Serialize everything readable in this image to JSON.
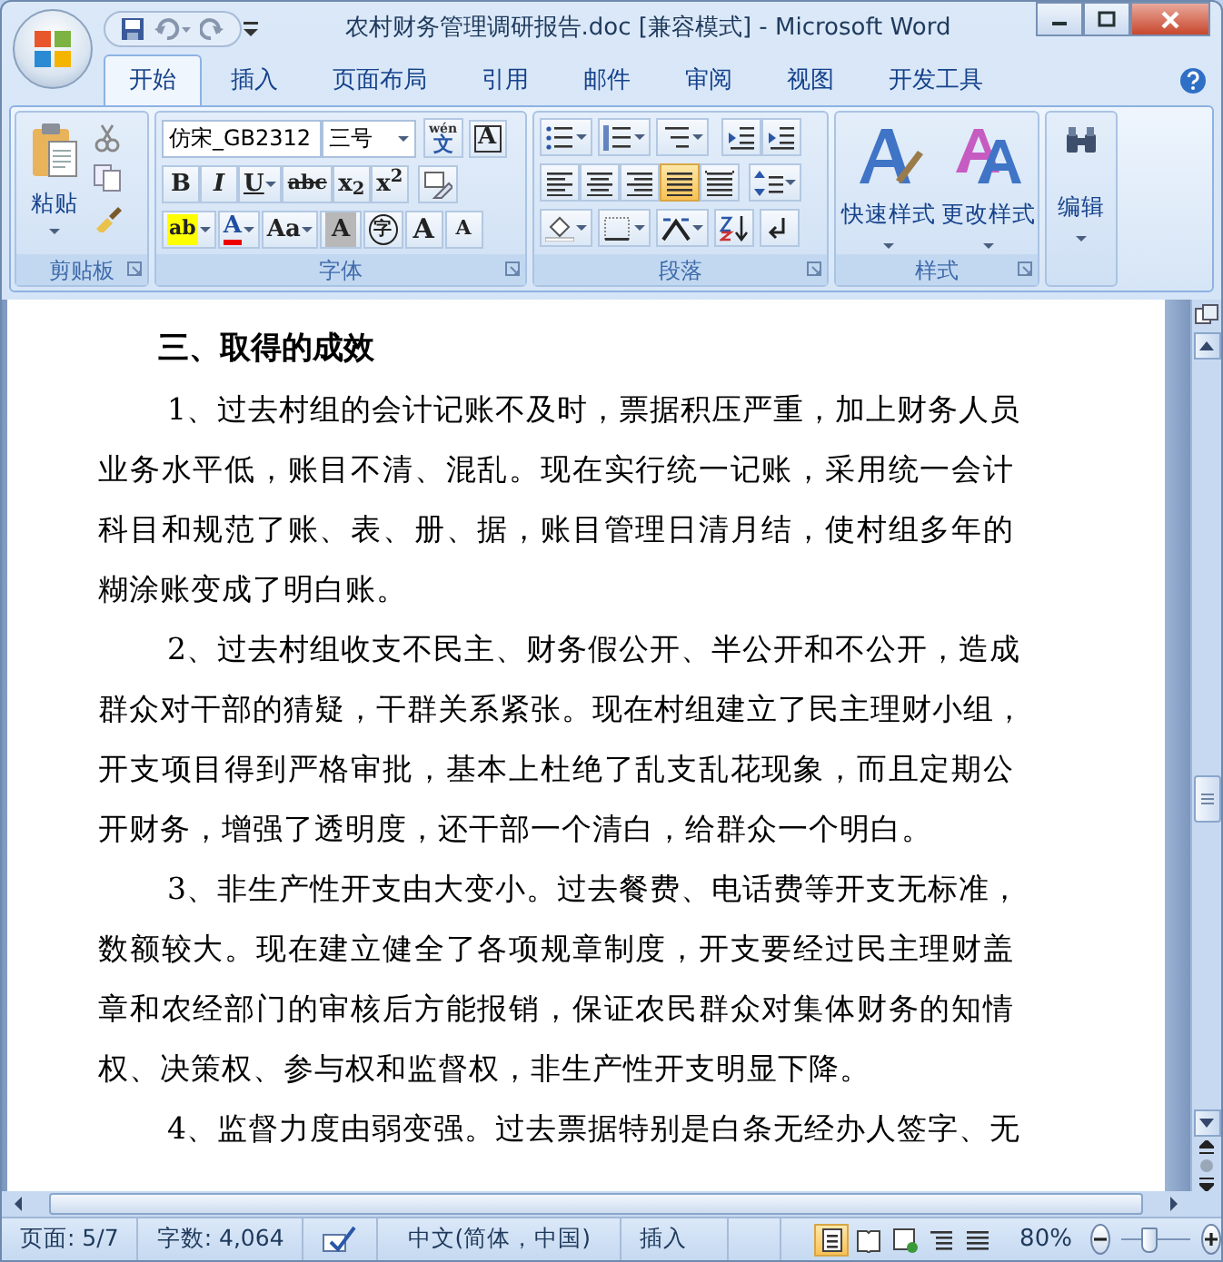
{
  "window": {
    "title": "农村财务管理调研报告.doc [兼容模式] - Microsoft Word"
  },
  "tabs": [
    {
      "label": "开始",
      "selected": true
    },
    {
      "label": "插入",
      "selected": false
    },
    {
      "label": "页面布局",
      "selected": false
    },
    {
      "label": "引用",
      "selected": false
    },
    {
      "label": "邮件",
      "selected": false
    },
    {
      "label": "审阅",
      "selected": false
    },
    {
      "label": "视图",
      "selected": false
    },
    {
      "label": "开发工具",
      "selected": false
    }
  ],
  "ribbon": {
    "clipboard": {
      "paste_label": "粘贴",
      "label": "剪贴板"
    },
    "font": {
      "font_name": "仿宋_GB2312",
      "font_size": "三号",
      "phonetic_ruby": "wén",
      "phonetic_glyph": "文",
      "border_glyph": "A",
      "label": "字体",
      "format_buttons": [
        {
          "kind": "bold",
          "glyph": "B",
          "dropdown": false
        },
        {
          "kind": "italic",
          "glyph": "I",
          "dropdown": false
        },
        {
          "kind": "underline",
          "glyph": "U",
          "dropdown": true
        },
        {
          "kind": "strike",
          "glyph": "abc",
          "dropdown": false
        },
        {
          "kind": "plain",
          "glyph": "x$_{2}$",
          "dropdown": false
        },
        {
          "kind": "plain",
          "glyph": "x$^{2}$",
          "dropdown": false
        }
      ],
      "effect_buttons": [
        {
          "kind": "highlight",
          "glyph": "ab",
          "dropdown": true
        },
        {
          "kind": "fontcolor",
          "glyph": "A",
          "dropdown": true
        },
        {
          "kind": "plain",
          "glyph": "Aa",
          "dropdown": true
        },
        {
          "kind": "shade",
          "glyph": "A",
          "dropdown": false
        },
        {
          "kind": "enclose",
          "glyph": "字",
          "dropdown": false
        },
        {
          "kind": "grow",
          "glyph": "A",
          "dropdown": false
        },
        {
          "kind": "shrink",
          "glyph": "A",
          "dropdown": false
        }
      ]
    },
    "paragraph": {
      "label": "段落",
      "alignments": [
        {
          "kind": "left",
          "selected": false
        },
        {
          "kind": "center",
          "selected": false
        },
        {
          "kind": "right",
          "selected": false
        },
        {
          "kind": "justify",
          "selected": true
        },
        {
          "kind": "distributed",
          "selected": false
        }
      ]
    },
    "styles": {
      "buttons": [
        "快速样式",
        "更改样式"
      ],
      "label": "样式"
    },
    "editing": {
      "label": "编辑"
    }
  },
  "document": {
    "heading": "三、取得的成效",
    "paragraphs": [
      {
        "lines": [
          "1、过去村组的会计记账不及时，票据积压严重，加上财务人员",
          "业务水平低，账目不清、混乱。现在实行统一记账，采用统一会计",
          "科目和规范了账、表、册、据，账目管理日清月结，使村组多年的",
          "糊涂账变成了明白账。"
        ]
      },
      {
        "lines": [
          "2、过去村组收支不民主、财务假公开、半公开和不公开，造成",
          "群众对干部的猜疑，干群关系紧张。现在村组建立了民主理财小组，",
          "开支项目得到严格审批，基本上杜绝了乱支乱花现象，而且定期公",
          "开财务，增强了透明度，还干部一个清白，给群众一个明白。"
        ]
      },
      {
        "lines": [
          "3、非生产性开支由大变小。过去餐费、电话费等开支无标准，",
          "数额较大。现在建立健全了各项规章制度，开支要经过民主理财盖",
          "章和农经部门的审核后方能报销，保证农民群众对集体财务的知情",
          "权、决策权、参与权和监督权，非生产性开支明显下降。"
        ]
      },
      {
        "lines": [
          "4、监督力度由弱变强。过去票据特别是白条无经办人签字、无"
        ]
      }
    ]
  },
  "status_bar": {
    "page": "页面: 5/7",
    "words": "字数: 4,064",
    "language": "中文(简体，中国)",
    "mode": "插入",
    "views": [
      {
        "selected": true
      },
      {
        "selected": false
      },
      {
        "selected": false
      },
      {
        "selected": false
      },
      {
        "selected": false
      }
    ],
    "zoom": "80%",
    "zoom_slider": {
      "level": 0.4
    }
  }
}
